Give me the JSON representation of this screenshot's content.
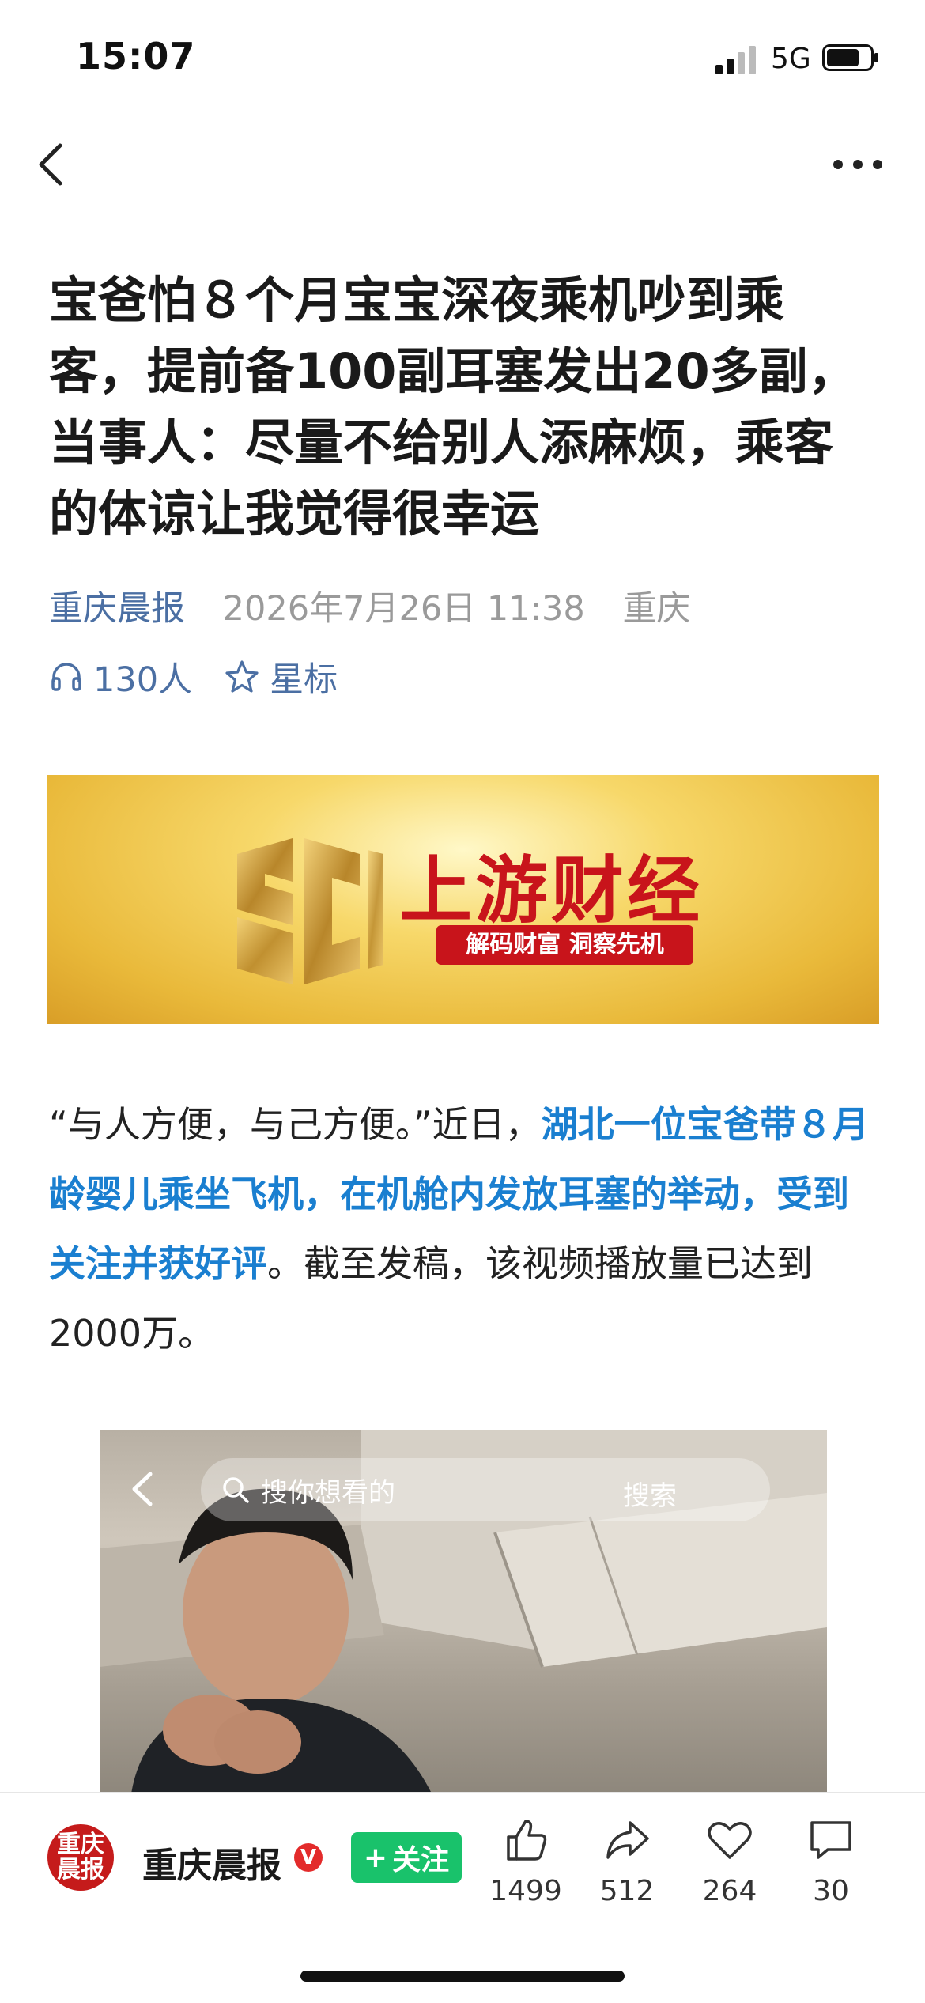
{
  "status_bar": {
    "time": "15:07",
    "network": "5G"
  },
  "article": {
    "title": "宝爸怕８个月宝宝深夜乘机吵到乘客，提前备100副耳塞发出20多副，当事人：尽量不给别人添麻烦，乘客的体谅让我觉得很幸运",
    "source": "重庆晨报",
    "date": "2026年7月26日 11:38",
    "location": "重庆",
    "listeners": "130人",
    "star_label": "星标",
    "paragraph": {
      "part1": "“与人方便，与己方便。”近日，",
      "highlight": "湖北一位宝爸带８月龄婴儿乘坐飞机，在机舱内发放耳塞的举动，受到关注并获好评",
      "part2": "。截至发稿，该视频播放量已达到2000万。"
    }
  },
  "banner": {
    "name": "上游财经",
    "slogan": "解码财富 洞察先机"
  },
  "video": {
    "search_placeholder": "搜你想看的",
    "search_button": "搜索"
  },
  "bottom_bar": {
    "avatar_text": "重庆晨报",
    "account_name": "重庆晨报",
    "verified": "V",
    "follow_label": "关注",
    "likes": "1499",
    "shares": "512",
    "favorites": "264",
    "comments": "30"
  },
  "colors": {
    "accent": "#4b6fa3",
    "highlight": "#1a7fd0",
    "follow": "#19c26b",
    "brand_red": "#c8141b"
  }
}
